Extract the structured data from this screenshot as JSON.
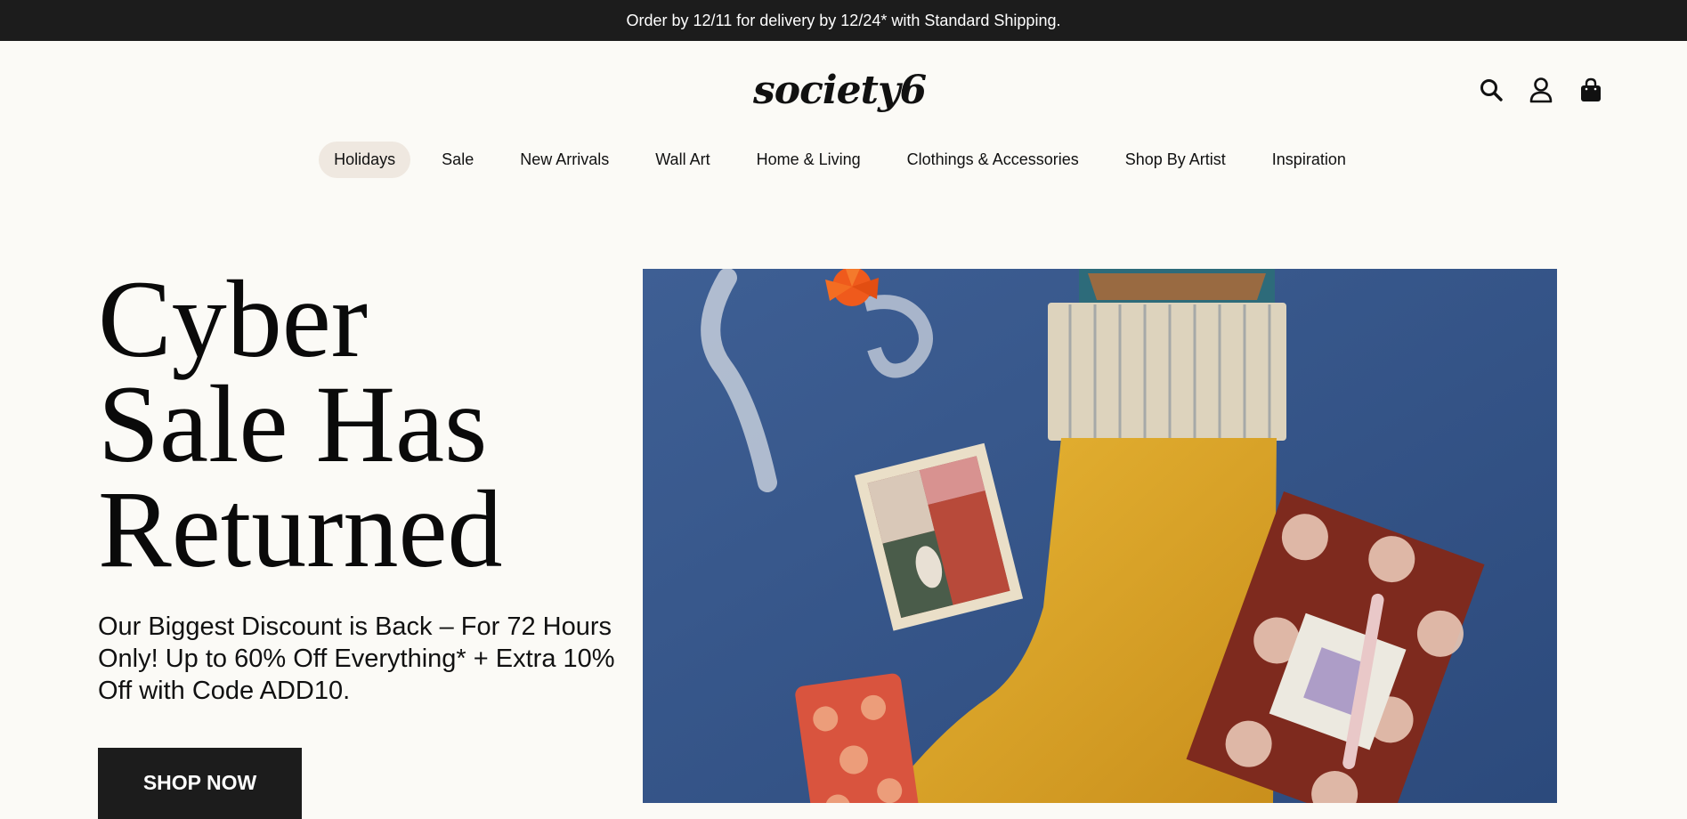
{
  "announcement": {
    "text": "Order by 12/11 for delivery by 12/24* with Standard Shipping."
  },
  "header": {
    "logo": "society6"
  },
  "nav": {
    "items": [
      {
        "label": "Holidays",
        "active": true
      },
      {
        "label": "Sale"
      },
      {
        "label": "New Arrivals"
      },
      {
        "label": "Wall Art"
      },
      {
        "label": "Home & Living"
      },
      {
        "label": "Clothings & Accessories"
      },
      {
        "label": "Shop By Artist"
      },
      {
        "label": "Inspiration"
      }
    ]
  },
  "hero": {
    "title_line1": "Cyber",
    "title_line2": "Sale Has",
    "title_line3": "Returned",
    "subtitle": "Our Biggest Discount is Back – For 72 Hours Only! Up to 60% Off Everything* + Extra 10% Off with Code ADD10.",
    "cta": "SHOP NOW"
  },
  "colors": {
    "background": "#fbfaf6",
    "topbar": "#1c1c1c",
    "active_pill": "#efe8e0",
    "image_backdrop": "#35558a"
  },
  "icons": [
    "search-icon",
    "user-icon",
    "shopping-bag-icon"
  ]
}
